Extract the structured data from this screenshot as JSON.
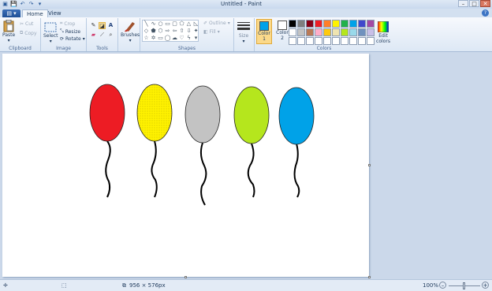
{
  "window": {
    "title": "Untitled - Paint"
  },
  "tabs": {
    "home": "Home",
    "view": "View"
  },
  "clipboard": {
    "paste": "Paste",
    "cut": "Cut",
    "copy": "Copy",
    "label": "Clipboard"
  },
  "image": {
    "select": "Select",
    "crop": "Crop",
    "resize": "Resize",
    "rotate": "Rotate",
    "label": "Image"
  },
  "tools": {
    "label": "Tools",
    "text_glyph": "A"
  },
  "brushes": {
    "label": "Brushes"
  },
  "shapes": {
    "outline": "Outline",
    "fill": "Fill",
    "label": "Shapes"
  },
  "size": {
    "label": "Size"
  },
  "colors": {
    "color1_label": "Color",
    "color1_num": "1",
    "color2_label": "Color",
    "color2_num": "2",
    "label": "Colors",
    "edit": "Edit colors",
    "color1": "#00a2e8",
    "color2": "#ffffff",
    "palette": [
      "#000000",
      "#7f7f7f",
      "#880015",
      "#ed1c24",
      "#ff7f27",
      "#fff200",
      "#22b14c",
      "#00a2e8",
      "#3f48cc",
      "#a349a4",
      "#ffffff",
      "#c3c3c3",
      "#b97a57",
      "#ffaec9",
      "#ffc90e",
      "#efe4b0",
      "#b5e61d",
      "#99d9ea",
      "#7092be",
      "#c8bfe7",
      "#ffffff",
      "#ffffff",
      "#ffffff",
      "#ffffff",
      "#ffffff",
      "#ffffff",
      "#ffffff",
      "#ffffff",
      "#ffffff",
      "#ffffff"
    ]
  },
  "balloons": [
    {
      "color": "#ed1c24",
      "dotted": false
    },
    {
      "color": "#fff200",
      "dotted": true
    },
    {
      "color": "#c3c3c3",
      "dotted": false
    },
    {
      "color": "#b5e61d",
      "dotted": false
    },
    {
      "color": "#00a2e8",
      "dotted": false
    }
  ],
  "status": {
    "size": "956 × 576px",
    "zoom": "100%"
  }
}
